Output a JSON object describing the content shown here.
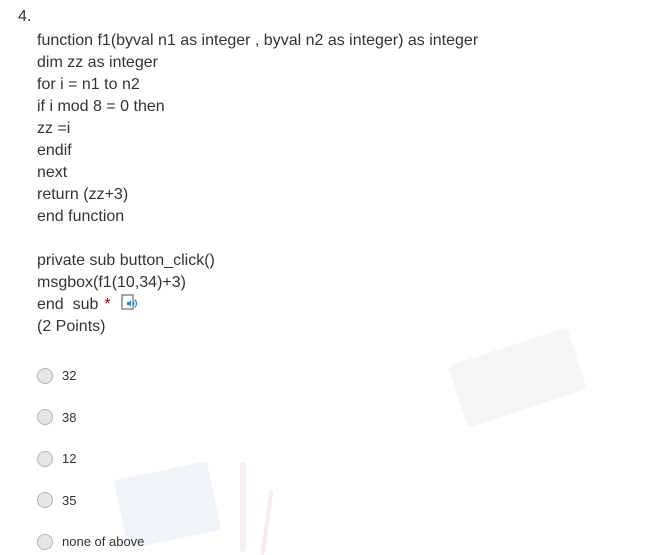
{
  "question": {
    "number": "4.",
    "code_lines_1": [
      "function f1(byval n1 as integer , byval n2 as integer) as integer",
      "dim zz as integer",
      "for i = n1 to n2",
      "if i mod 8 = 0 then",
      "zz =i",
      "endif",
      "next",
      "return (zz+3)",
      "end function"
    ],
    "code_lines_2": [
      "private sub button_click()",
      "msgbox(f1(10,34)+3)"
    ],
    "last_line": "end  sub",
    "required_mark": "*",
    "points": "(2 Points)",
    "speaker_icon": "immersive-reader-icon"
  },
  "options": [
    {
      "label": "32"
    },
    {
      "label": "38"
    },
    {
      "label": "12"
    },
    {
      "label": "35"
    },
    {
      "label": "none of above"
    }
  ],
  "colors": {
    "text": "#333333",
    "required": "#a80000",
    "icon_blue": "#2b88d8",
    "radio_fill": "#e6e6e6",
    "radio_border": "#b3b3b3"
  }
}
